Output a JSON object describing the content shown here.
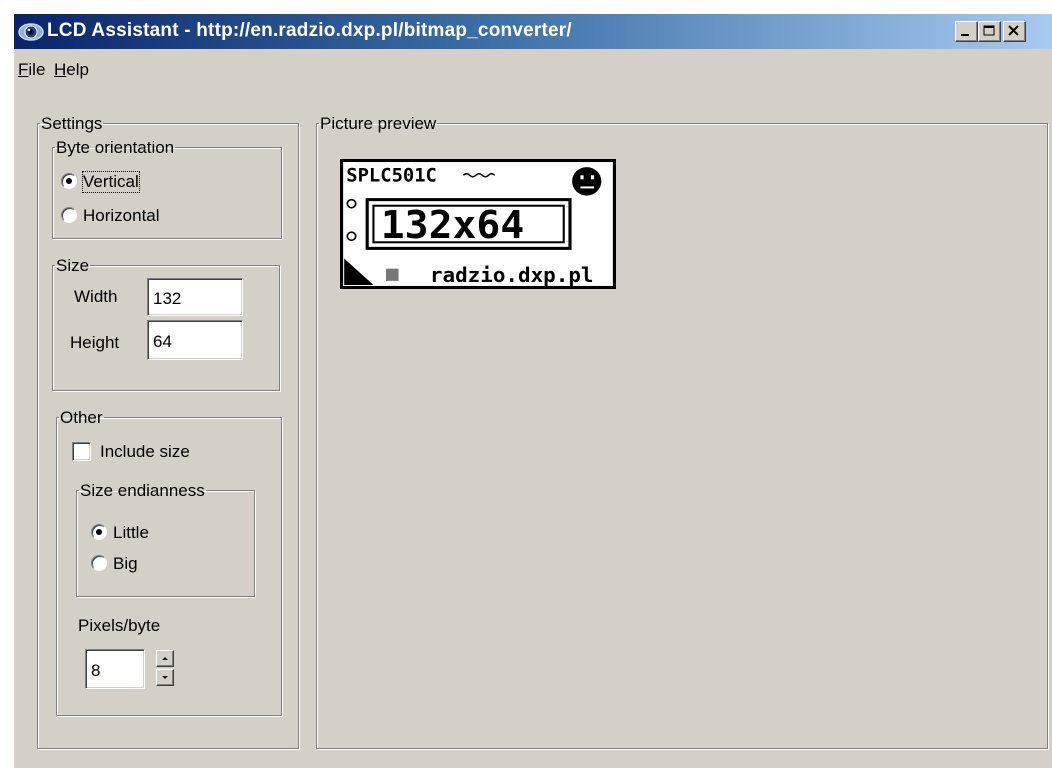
{
  "window": {
    "title": "LCD Assistant - http://en.radzio.dxp.pl/bitmap_converter/",
    "controls": {
      "minimize": "_",
      "maximize": "□",
      "close": "×"
    }
  },
  "menu": {
    "file": {
      "key": "F",
      "rest": "ile"
    },
    "help": {
      "key": "H",
      "rest": "elp"
    }
  },
  "settings": {
    "legend": "Settings",
    "byte_orientation": {
      "legend": "Byte orientation",
      "vertical": "Vertical",
      "horizontal": "Horizontal",
      "selected": "Vertical"
    },
    "size": {
      "legend": "Size",
      "width_label": "Width",
      "width_value": "132",
      "height_label": "Height",
      "height_value": "64"
    },
    "other": {
      "legend": "Other",
      "include_size": "Include size",
      "include_size_checked": false,
      "endianness": {
        "legend": "Size endianness",
        "little": "Little",
        "big": "Big",
        "selected": "Little"
      },
      "pixels_per_byte_label": "Pixels/byte",
      "pixels_per_byte_value": "8"
    }
  },
  "preview": {
    "legend": "Picture preview",
    "image": {
      "line1": "SPLC501C",
      "big": "132x64",
      "footer": "radzio.dxp.pl"
    }
  },
  "colors": {
    "face": "#d4d0c8",
    "title_start": "#0a246a",
    "title_end": "#a6caf0",
    "title_text": "#ffffff"
  },
  "icons": {
    "app": "lcd-assistant-eye-icon",
    "minimize": "minimize-icon",
    "maximize": "maximize-icon",
    "close": "close-icon",
    "spin_up": "up-arrow-icon",
    "spin_down": "down-arrow-icon"
  }
}
